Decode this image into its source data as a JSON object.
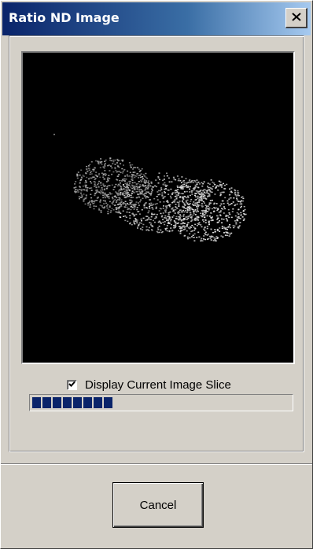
{
  "window": {
    "title": "Ratio ND Image"
  },
  "titlebar_icons": {
    "close": "close-icon"
  },
  "preview": {
    "checkbox_label": "Display Current Image Slice",
    "checkbox_checked": true
  },
  "progress": {
    "fraction": 0.3
  },
  "buttons": {
    "cancel_label": "Cancel"
  },
  "colors": {
    "title_gradient_start": "#0a246a",
    "title_gradient_end": "#a6caf0",
    "progress_fill": "#0a246a",
    "background": "#d4d0c8"
  }
}
